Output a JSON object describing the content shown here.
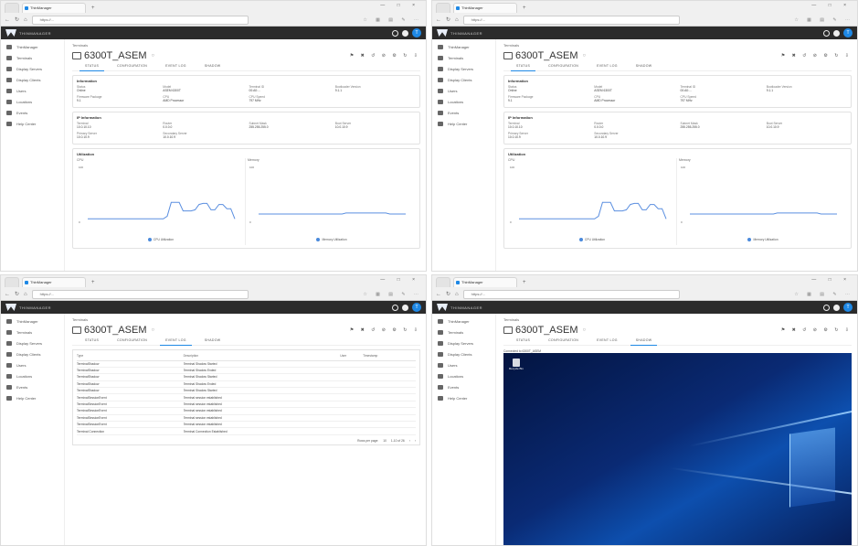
{
  "browser": {
    "tab_title": "ThinManager",
    "url": "https://...",
    "window_controls": "— □ ×"
  },
  "app": {
    "logo_text": "THINMANAGER",
    "avatar_letter": "T"
  },
  "sidebar": {
    "items": [
      {
        "label": "ThinManager",
        "icon": "server-icon"
      },
      {
        "label": "Terminals",
        "icon": "monitor-icon"
      },
      {
        "label": "Display Servers",
        "icon": "display-server-icon"
      },
      {
        "label": "Display Clients",
        "icon": "display-client-icon"
      },
      {
        "label": "Users",
        "icon": "user-icon"
      },
      {
        "label": "Locations",
        "icon": "location-icon"
      },
      {
        "label": "Events",
        "icon": "event-icon"
      },
      {
        "label": "Help Center",
        "icon": "help-icon"
      }
    ]
  },
  "page": {
    "breadcrumb": "Terminals",
    "title": "6300T_ASEM",
    "title_suffix": "○",
    "tabs": [
      "STATUS",
      "CONFIGURATION",
      "EVENT LOG",
      "SHADOW"
    ],
    "toolbar_icons": "⚑ ✖ ↺ ⊘ ⚙ ↻ ⇩"
  },
  "status": {
    "information_header": "Information",
    "information_fields": [
      {
        "label": "Status",
        "value": "Online"
      },
      {
        "label": "Model",
        "value": "ASEM 6300T"
      },
      {
        "label": "Terminal ID",
        "value": "00:A0:..."
      },
      {
        "label": "Bootloader Version",
        "value": "9.1.1"
      },
      {
        "label": "Firmware Package",
        "value": "9.1"
      },
      {
        "label": "CPU",
        "value": "AMD Processor"
      },
      {
        "label": "CPU Speed",
        "value": "797 MHz"
      }
    ],
    "ip_header": "IP Information",
    "ip_fields": [
      {
        "label": "Terminal",
        "value": "10.0.10.10"
      },
      {
        "label": "Router",
        "value": "0.0.0.0"
      },
      {
        "label": "Subnet Mask",
        "value": "255.255.255.0"
      },
      {
        "label": "Boot Server",
        "value": "10.0.10.9"
      },
      {
        "label": "Primary Server",
        "value": "10.0.10.9"
      },
      {
        "label": "Secondary Server",
        "value": "10.0.10.9"
      }
    ],
    "utilization_header": "Utilization",
    "cpu_label": "CPU",
    "memory_label": "Memory",
    "cpu_legend": "CPU Utilization",
    "memory_legend": "Memory Utilization",
    "y_top": "100",
    "y_bottom": "0"
  },
  "chart_data": [
    {
      "type": "line",
      "title": "CPU",
      "series": [
        {
          "name": "CPU Utilization",
          "values": [
            3,
            3,
            3,
            3,
            3,
            3,
            3,
            3,
            3,
            3,
            3,
            3,
            3,
            3,
            3,
            3,
            3,
            3,
            3,
            3,
            8,
            34,
            34,
            34,
            18,
            18,
            18,
            20,
            30,
            32,
            32,
            20,
            20,
            30,
            30,
            22,
            22,
            3
          ]
        }
      ],
      "ylim": [
        0,
        100
      ]
    },
    {
      "type": "line",
      "title": "Memory",
      "series": [
        {
          "name": "Memory Utilization",
          "values": [
            12,
            12,
            12,
            12,
            12,
            12,
            12,
            12,
            12,
            12,
            12,
            12,
            12,
            12,
            12,
            12,
            12,
            12,
            12,
            12,
            12,
            12,
            14,
            14,
            14,
            14,
            14,
            14,
            14,
            14,
            14,
            14,
            14,
            12,
            12,
            12,
            12,
            12
          ]
        }
      ],
      "ylim": [
        0,
        100
      ]
    }
  ],
  "event_log": {
    "headers": [
      "Type",
      "Description",
      "User",
      "Timestamp"
    ],
    "rows": [
      [
        "TerminalShadow",
        "Terminal Shadow Started",
        "",
        ""
      ],
      [
        "TerminalShadow",
        "Terminal Shadow Ended",
        "",
        ""
      ],
      [
        "TerminalShadow",
        "Terminal Shadow Started",
        "",
        ""
      ],
      [
        "TerminalShadow",
        "Terminal Shadow Ended",
        "",
        ""
      ],
      [
        "TerminalShadow",
        "Terminal Shadow Started",
        "",
        ""
      ],
      [
        "TerminalSessionEvent",
        "Terminal session established",
        "",
        ""
      ],
      [
        "TerminalSessionEvent",
        "Terminal session established",
        "",
        ""
      ],
      [
        "TerminalSessionEvent",
        "Terminal session established",
        "",
        ""
      ],
      [
        "TerminalSessionEvent",
        "Terminal session established",
        "",
        ""
      ],
      [
        "TerminalSessionEvent",
        "Terminal session established",
        "",
        ""
      ],
      [
        "Terminal Connection",
        "Terminal Connection Established",
        "",
        ""
      ]
    ],
    "pager": [
      "Rows per page:",
      "10",
      "1-10 of 26",
      "‹",
      "›"
    ]
  },
  "shadow": {
    "label": "Connected to 6300T_ASEM",
    "recycle_bin_label": "Recycle Bin"
  }
}
